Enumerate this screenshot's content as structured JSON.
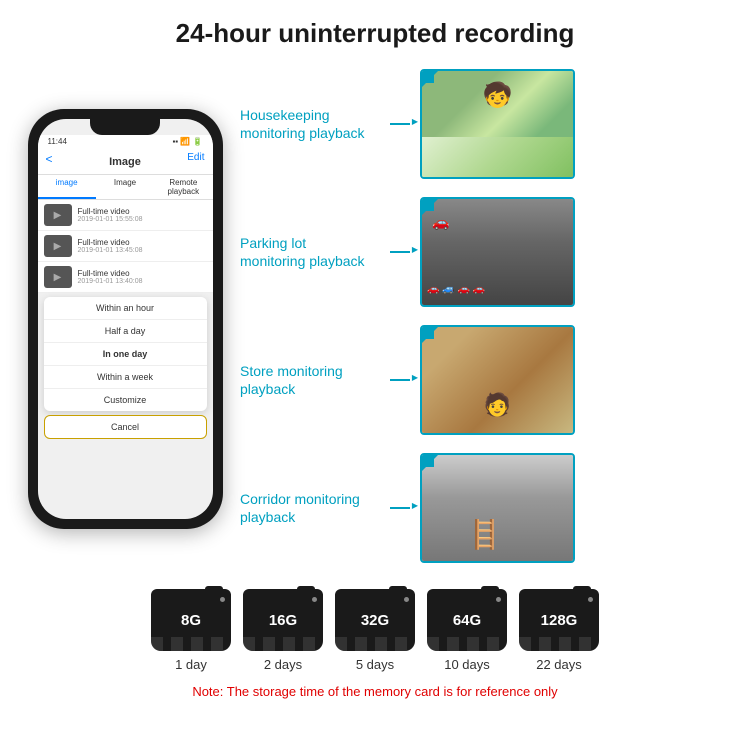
{
  "header": {
    "title": "24-hour uninterrupted recording"
  },
  "phone": {
    "status_time": "11:44",
    "app_title": "Image",
    "back_label": "<",
    "edit_label": "Edit",
    "tabs": [
      "image",
      "Image",
      "Remote playback"
    ],
    "video_items": [
      {
        "title": "Full-time video",
        "date": "2019-01-01 15:55:08"
      },
      {
        "title": "Full-time video",
        "date": "2019-01-01 13:45:08"
      },
      {
        "title": "Full-time video",
        "date": "2019-01-01 13:40:08"
      }
    ],
    "dropdown": {
      "items": [
        "Within an hour",
        "Half a day",
        "In one day",
        "Within a week",
        "Customize"
      ],
      "active_index": 2
    },
    "cancel_label": "Cancel"
  },
  "monitoring": {
    "items": [
      {
        "label": "Housekeeping\nmonitoring playback",
        "photo_type": "child"
      },
      {
        "label": "Parking lot\nmonitoring playback",
        "photo_type": "parking"
      },
      {
        "label": "Store monitoring\nplayback",
        "photo_type": "store"
      },
      {
        "label": "Corridor monitoring\nplayback",
        "photo_type": "corridor"
      }
    ]
  },
  "storage": {
    "cards": [
      {
        "size": "8G",
        "days": "1 day"
      },
      {
        "size": "16G",
        "days": "2 days"
      },
      {
        "size": "32G",
        "days": "5 days"
      },
      {
        "size": "64G",
        "days": "10 days"
      },
      {
        "size": "128G",
        "days": "22 days"
      }
    ],
    "note": "Note: The storage time of the memory card is for reference only"
  }
}
